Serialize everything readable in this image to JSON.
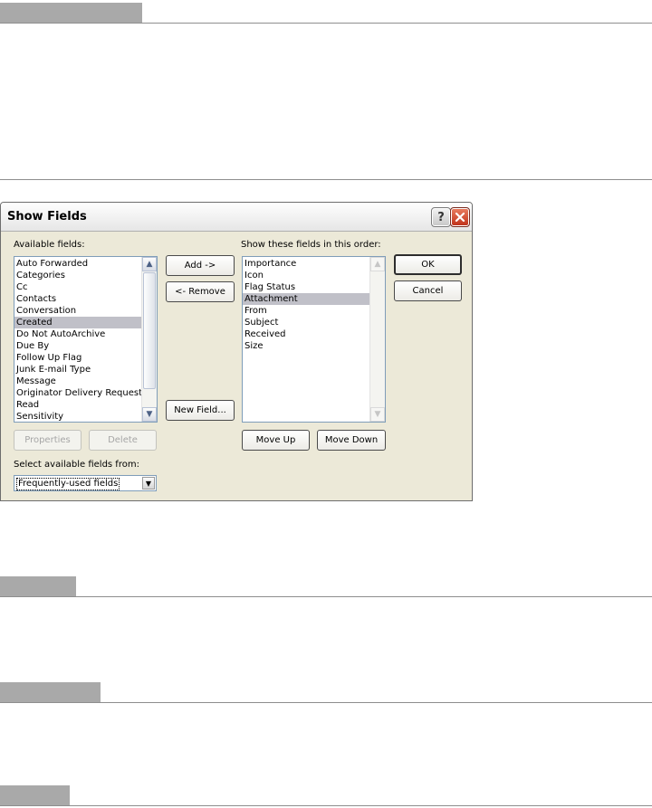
{
  "dialog": {
    "title": "Show Fields",
    "help_icon": "question-mark-icon",
    "close_icon": "close-x-icon",
    "available_label": "Available fields:",
    "available_fields": [
      "Auto Forwarded",
      "Categories",
      "Cc",
      "Contacts",
      "Conversation",
      "Created",
      "Do Not AutoArchive",
      "Due By",
      "Follow Up Flag",
      "Junk E-mail Type",
      "Message",
      "Originator Delivery Requested",
      "Read",
      "Sensitivity"
    ],
    "available_selected": "Created",
    "show_label": "Show these fields in this order:",
    "shown_fields": [
      "Importance",
      "Icon",
      "Flag Status",
      "Attachment",
      "From",
      "Subject",
      "Received",
      "Size"
    ],
    "shown_selected": "Attachment",
    "buttons": {
      "add": "Add ->",
      "remove": "<- Remove",
      "new_field": "New Field...",
      "ok": "OK",
      "cancel": "Cancel",
      "properties": "Properties",
      "delete": "Delete",
      "move_up": "Move Up",
      "move_down": "Move Down"
    },
    "select_from_label": "Select available fields from:",
    "select_from_value": "Frequently-used fields"
  }
}
